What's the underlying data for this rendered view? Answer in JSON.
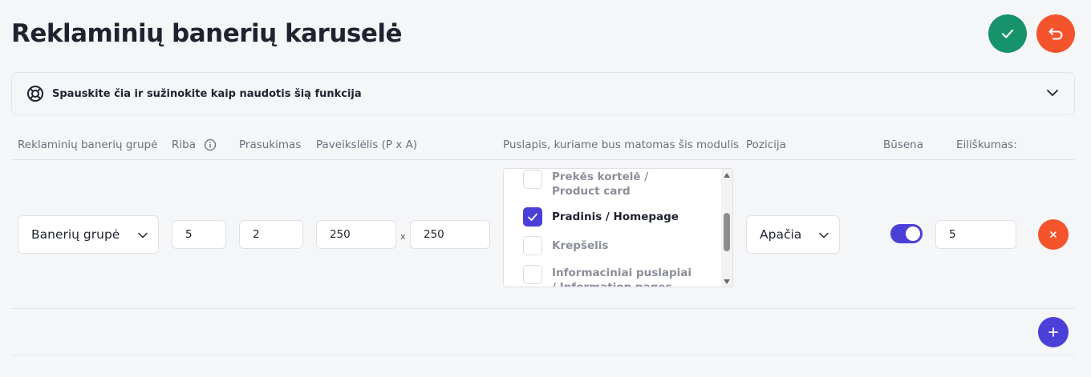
{
  "page": {
    "title": "Reklaminių banerių karuselė"
  },
  "actions": {
    "save_icon": "check-icon",
    "back_icon": "undo-arrow-icon"
  },
  "help": {
    "text": "Spauskite čia ir sužinokite kaip naudotis šią funkcija",
    "icon": "lifebuoy-icon"
  },
  "table": {
    "headers": {
      "group": "Reklaminių banerių grupė",
      "limit": "Riba",
      "scroll": "Prasukimas",
      "image": "Paveikslėlis (P x A)",
      "page": "Puslapis, kuriame bus matomas šis modulis",
      "position": "Pozicija",
      "status": "Būsena",
      "order": "Eiliškumas:"
    },
    "row": {
      "group": "Banerių grupė",
      "limit": "5",
      "scroll": "2",
      "image_width": "250",
      "image_separator": "x",
      "image_height": "250",
      "pages": [
        {
          "label": "Prekės kortelė / Product card",
          "checked": false
        },
        {
          "label": "Pradinis / Homepage",
          "checked": true
        },
        {
          "label": "Krepšelis",
          "checked": false
        },
        {
          "label": "Informaciniai puslapiai / Information pages",
          "checked": false
        }
      ],
      "position": "Apačia",
      "status_enabled": true,
      "order": "5"
    }
  },
  "colors": {
    "accent": "#4a3fd6",
    "save": "#16936a",
    "danger": "#f4542b"
  }
}
